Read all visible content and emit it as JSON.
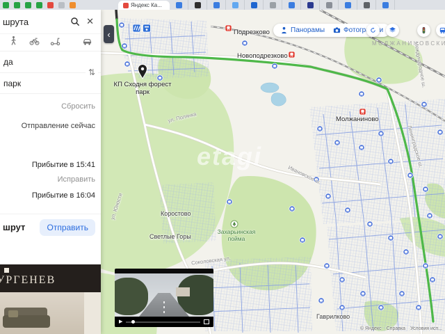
{
  "colors": {
    "accent_blue": "#2b6cdf",
    "route_green": "#4eb849",
    "transit_blue": "#4a72d8",
    "station_red": "#e0382c",
    "map_bg": "#f3f2ec",
    "forest_green": "#d2e8b6",
    "water_blue": "#a9d3e6"
  },
  "browser": {
    "active_tab_title": "Яндекс Ка...",
    "pinned_tabs": [
      "#27a344",
      "#27a344",
      "#27a344",
      "#27a344",
      "#e3493e",
      "#b9bec4",
      "#ef8e2e"
    ],
    "other_tabs": [
      "#3b7de0",
      "#2f2f2f",
      "#3b7de0",
      "#62a8f0",
      "#1f66d0",
      "#9aa0a6",
      "#3b7de0",
      "#2b3a8f",
      "#8a8f98",
      "#3b7de0",
      "#5f6368",
      "#3b7de0"
    ]
  },
  "icons": {
    "close": "✕",
    "swap": "⇅",
    "back": "‹",
    "play": "▶"
  },
  "sidebar": {
    "title": "шрута",
    "from_value": "да",
    "to_value": "парк",
    "reset": "Сбросить",
    "departure": "Отправление сейчас",
    "route_a_arrival": "Прибытие в 15:41",
    "fix": "Исправить",
    "route_b_arrival": "Прибытие в 16:04",
    "route_title": "шрут",
    "send": "Отправить",
    "ad_brand": "УРГЕНЕВ"
  },
  "map": {
    "buttons": {
      "panoramas": "Панорамы",
      "photos": "Фотографии"
    },
    "labels": {
      "podrezkovo": "Подрезково",
      "novopodrezkovo": "Новоподрезково",
      "molzhaninovo": "Молжаниново",
      "district": "МОЛЖАНИНОВСКИЙ",
      "kp_line1": "КП Сходня форест",
      "kp_line2": "парк",
      "polyanka": "ул. Полянка",
      "ivanovskoe": "Ивановское ш.",
      "korostovo": "Коростово",
      "svetlye_gory": "Светлые Горы",
      "zakharinskaya_line1": "Захарьинская",
      "zakharinskaya_line2": "пойма",
      "sokolovskaya": "Соколовская ул.",
      "gavrilkovo": "Гаврилково",
      "yunosti": "ул. Юности",
      "leningradskoe": "Ленинградское ш.",
      "mezhdunarodnoe": "Международное ш."
    },
    "watermark": "etagi",
    "attribution": {
      "copyright": "© Яндекс",
      "help": "Справка",
      "terms": "Условия исп..."
    }
  }
}
